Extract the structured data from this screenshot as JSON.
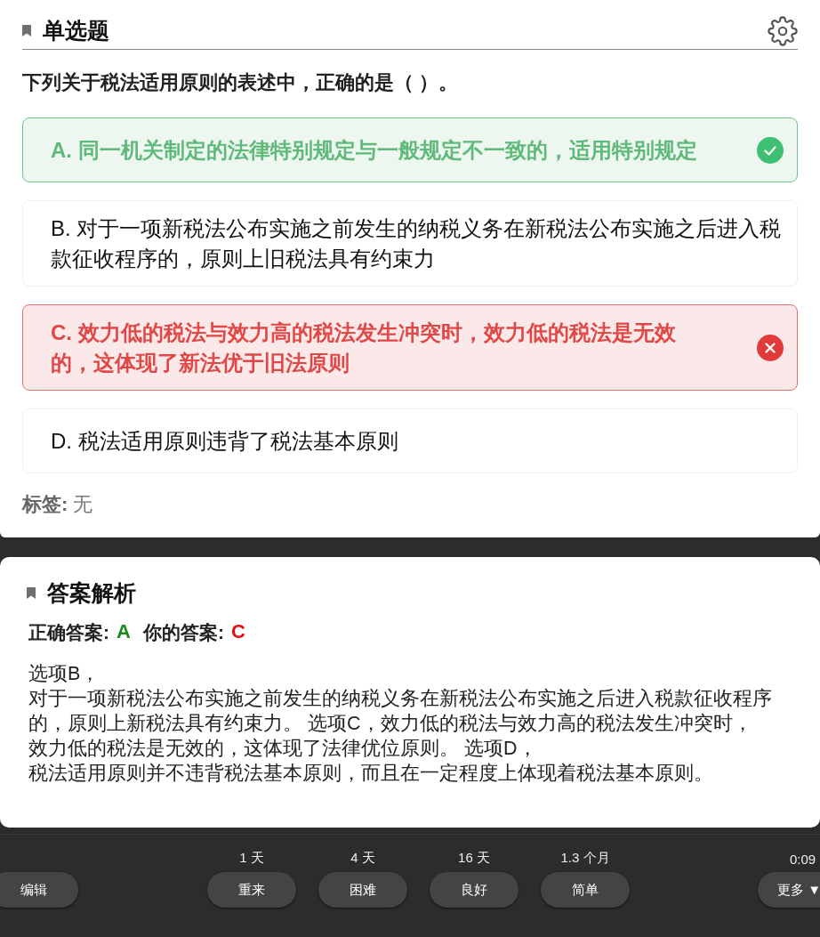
{
  "question": {
    "type_label": "单选题",
    "stem": "下列关于税法适用原则的表述中，正确的是（ ）。",
    "options": [
      {
        "text": "A. 同一机关制定的法律特别规定与一般规定不一致的，适用特别规定",
        "correct": true,
        "selected": false
      },
      {
        "text": "B. 对于一项新税法公布实施之前发生的纳税义务在新税法公布实施之后进入税款征收程序的，原则上旧税法具有约束力",
        "correct": false,
        "selected": false
      },
      {
        "text": "C. 效力低的税法与效力高的税法发生冲突时，效力低的税法是无效的，这体现了新法优于旧法原则",
        "correct": false,
        "selected": true
      },
      {
        "text": "D. 税法适用原则违背了税法基本原则",
        "correct": false,
        "selected": false
      }
    ],
    "tags_label": "标签:",
    "tags_value": "无"
  },
  "analysis": {
    "title": "答案解析",
    "correct_label": "正确答案:",
    "correct_value": "A",
    "your_label": "你的答案:",
    "your_value": "C",
    "lines": [
      "选项B，",
      "对于一项新税法公布实施之前发生的纳税义务在新税法公布实施之后进入税款征收程序",
      "的，原则上新税法具有约束力。 选项C，效力低的税法与效力高的税法发生冲突时，",
      "效力低的税法是无效的，这体现了法律优位原则。 选项D，",
      "税法适用原则并不违背税法基本原则，而且在一定程度上体现着税法基本原则。"
    ]
  },
  "bottom_bar": {
    "edit_button": "编辑",
    "answers": [
      {
        "interval": "1 天",
        "label": "重来"
      },
      {
        "interval": "4 天",
        "label": "困难"
      },
      {
        "interval": "16 天",
        "label": "良好"
      },
      {
        "interval": "1.3 个月",
        "label": "简单"
      }
    ],
    "timer": "0:09",
    "more_button": "更多 ▼"
  }
}
